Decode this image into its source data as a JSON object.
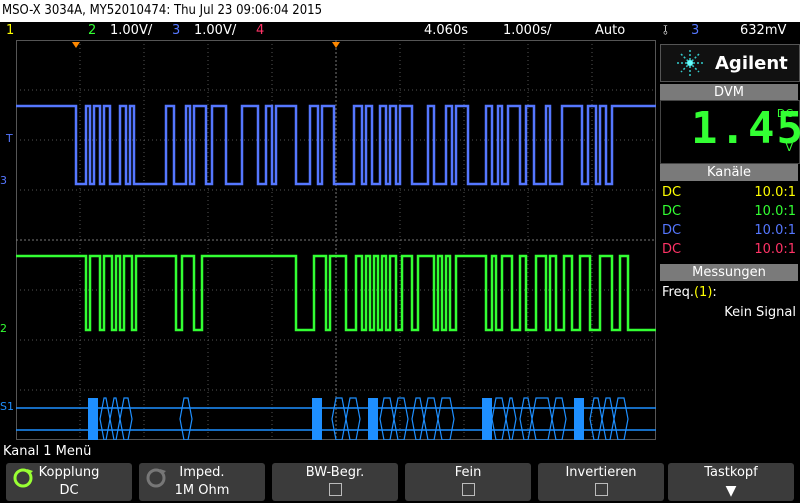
{
  "title": "MSO-X 3034A, MY52010474: Thu Jul 23 09:06:04 2015",
  "status": {
    "ch1_num": "1",
    "ch2_num": "2",
    "ch2_scale": "1.00V/",
    "ch3_num": "3",
    "ch3_scale": "1.00V/",
    "ch4_num": "4",
    "time_pos": "4.060s",
    "time_scale": "1.000s/",
    "trigger_mode": "Auto",
    "trigger_icon": "edge-trigger-icon",
    "trigger_ch": "3",
    "trigger_level": "632mV"
  },
  "logo": {
    "text": "Agilent",
    "icon": "agilent-spark-icon"
  },
  "dvm": {
    "header": "DVM",
    "value": "1.45",
    "mode": "DC",
    "unit": "V"
  },
  "channels": {
    "header": "Kanäle",
    "rows": [
      {
        "coupling": "DC",
        "probe": "10.0:1",
        "color": "#ffff00"
      },
      {
        "coupling": "DC",
        "probe": "10.0:1",
        "color": "#33ff33"
      },
      {
        "coupling": "DC",
        "probe": "10.0:1",
        "color": "#5577ff"
      },
      {
        "coupling": "DC",
        "probe": "10.0:1",
        "color": "#ff3366"
      }
    ]
  },
  "measurements": {
    "header": "Messungen",
    "label_prefix": "Freq.",
    "label_channel": "(1)",
    "label_suffix": ":",
    "value": "Kein Signal"
  },
  "menu_title": "Kanal 1 Menü",
  "softkeys": [
    {
      "label": "Kopplung",
      "value": "DC",
      "icon": "rotary-knob-icon"
    },
    {
      "label": "Imped.",
      "value": "1M Ohm",
      "icon": "rotary-knob-icon"
    },
    {
      "label": "BW-Begr.",
      "value": "",
      "checkbox": true
    },
    {
      "label": "Fein",
      "value": "",
      "checkbox": true
    },
    {
      "label": "Invertieren",
      "value": "",
      "checkbox": true
    },
    {
      "label": "Tastkopf",
      "value": "",
      "icon": "down-arrow-icon"
    }
  ],
  "colors": {
    "ch1": "#ffff00",
    "ch2": "#33ff33",
    "ch3": "#5577ff",
    "ch4": "#ff3366",
    "serial": "#1e8fff",
    "grid": "#555555"
  },
  "markers": {
    "ch3": "3",
    "ch2": "2",
    "trigger": "T",
    "serial": "S1"
  }
}
